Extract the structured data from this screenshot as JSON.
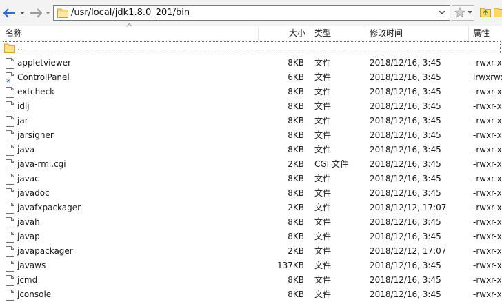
{
  "address": {
    "path": "/usr/local/jdk1.8.0_201/bin"
  },
  "header": {
    "name": "名称",
    "size": "大小",
    "type": "类型",
    "mtime": "修改时间",
    "attr": "属性"
  },
  "parent_row": {
    "name": ".."
  },
  "files": [
    {
      "name": "appletviewer",
      "size": "8KB",
      "type": "文件",
      "mtime": "2018/12/16, 3:45",
      "attr": "-rwxr-xr-x",
      "icon": "file-icon"
    },
    {
      "name": "ControlPanel",
      "size": "6KB",
      "type": "文件",
      "mtime": "2018/12/16, 3:45",
      "attr": "lrwxrwxrwx",
      "icon": "shortcut-icon"
    },
    {
      "name": "extcheck",
      "size": "8KB",
      "type": "文件",
      "mtime": "2018/12/16, 3:45",
      "attr": "-rwxr-xr-x",
      "icon": "file-icon"
    },
    {
      "name": "idlj",
      "size": "8KB",
      "type": "文件",
      "mtime": "2018/12/16, 3:45",
      "attr": "-rwxr-xr-x",
      "icon": "file-icon"
    },
    {
      "name": "jar",
      "size": "8KB",
      "type": "文件",
      "mtime": "2018/12/16, 3:45",
      "attr": "-rwxr-xr-x",
      "icon": "file-icon"
    },
    {
      "name": "jarsigner",
      "size": "8KB",
      "type": "文件",
      "mtime": "2018/12/16, 3:45",
      "attr": "-rwxr-xr-x",
      "icon": "file-icon"
    },
    {
      "name": "java",
      "size": "8KB",
      "type": "文件",
      "mtime": "2018/12/16, 3:45",
      "attr": "-rwxr-xr-x",
      "icon": "file-icon"
    },
    {
      "name": "java-rmi.cgi",
      "size": "2KB",
      "type": "CGI 文件",
      "mtime": "2018/12/16, 3:45",
      "attr": "-rwxr-xr-x",
      "icon": "file-icon"
    },
    {
      "name": "javac",
      "size": "8KB",
      "type": "文件",
      "mtime": "2018/12/16, 3:45",
      "attr": "-rwxr-xr-x",
      "icon": "file-icon"
    },
    {
      "name": "javadoc",
      "size": "8KB",
      "type": "文件",
      "mtime": "2018/12/16, 3:45",
      "attr": "-rwxr-xr-x",
      "icon": "file-icon"
    },
    {
      "name": "javafxpackager",
      "size": "2KB",
      "type": "文件",
      "mtime": "2018/12/12, 17:07",
      "attr": "-rwxr-xr-x",
      "icon": "file-icon"
    },
    {
      "name": "javah",
      "size": "8KB",
      "type": "文件",
      "mtime": "2018/12/16, 3:45",
      "attr": "-rwxr-xr-x",
      "icon": "file-icon"
    },
    {
      "name": "javap",
      "size": "8KB",
      "type": "文件",
      "mtime": "2018/12/16, 3:45",
      "attr": "-rwxr-xr-x",
      "icon": "file-icon"
    },
    {
      "name": "javapackager",
      "size": "2KB",
      "type": "文件",
      "mtime": "2018/12/12, 17:07",
      "attr": "-rwxr-xr-x",
      "icon": "file-icon"
    },
    {
      "name": "javaws",
      "size": "137KB",
      "type": "文件",
      "mtime": "2018/12/16, 3:45",
      "attr": "-rwxr-xr-x",
      "icon": "file-icon"
    },
    {
      "name": "jcmd",
      "size": "8KB",
      "type": "文件",
      "mtime": "2018/12/16, 3:45",
      "attr": "-rwxr-xr-x",
      "icon": "file-icon"
    },
    {
      "name": "jconsole",
      "size": "8KB",
      "type": "文件",
      "mtime": "2018/12/16, 3:45",
      "attr": "-rwxr-xr-x",
      "icon": "file-icon"
    }
  ]
}
